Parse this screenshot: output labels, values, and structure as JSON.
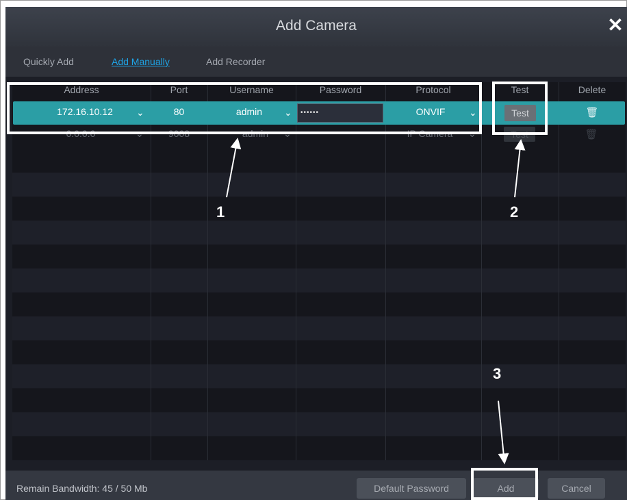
{
  "dialog": {
    "title": "Add Camera",
    "close_symbol": "✕"
  },
  "tabs": [
    {
      "label": "Quickly Add",
      "active": false
    },
    {
      "label": "Add Manually",
      "active": true
    },
    {
      "label": "Add Recorder",
      "active": false
    }
  ],
  "table": {
    "columns": [
      "Address",
      "Port",
      "Username",
      "Password",
      "Protocol",
      "Test",
      "Delete"
    ],
    "rows": [
      {
        "address": "172.16.10.12",
        "port": "80",
        "username": "admin",
        "password": "••••••",
        "protocol": "ONVIF",
        "test": "Test",
        "selected": true
      },
      {
        "address": "0.0.0.0",
        "port": "9008",
        "username": "admin",
        "password": "",
        "protocol": "IP Camera",
        "test": "Test",
        "selected": false
      }
    ],
    "delete_icon": "trash-icon",
    "dropdown_icon": "chevron-down-icon"
  },
  "footer": {
    "bandwidth": "Remain Bandwidth: 45 / 50 Mb",
    "default_password": "Default Password",
    "add": "Add",
    "cancel": "Cancel"
  },
  "callouts": [
    "1",
    "2",
    "3"
  ],
  "colors": {
    "dialog_bg": "#1c1e26",
    "selected_row": "#2b9ea5",
    "active_tab": "#1ea4e6",
    "callout": "#ffffff"
  }
}
